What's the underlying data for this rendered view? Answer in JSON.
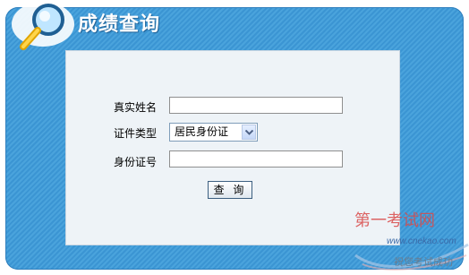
{
  "header": {
    "title": "成绩查询"
  },
  "form": {
    "name_label": "真实姓名",
    "id_type_label": "证件类型",
    "id_type_selected": "居民身份证",
    "id_number_label": "身份证号",
    "name_value": "",
    "id_number_value": "",
    "submit_label": "查 询"
  },
  "watermark": {
    "site_name": "第一考试网",
    "url": "www.cnekao.com",
    "slogan": "祝您考试成功"
  },
  "colors": {
    "panel_blue": "#3b95d3",
    "form_bg": "#eef3f7",
    "watermark_red": "#d94a4a"
  },
  "icons": [
    "magnifier-icon",
    "chevron-down-icon"
  ]
}
